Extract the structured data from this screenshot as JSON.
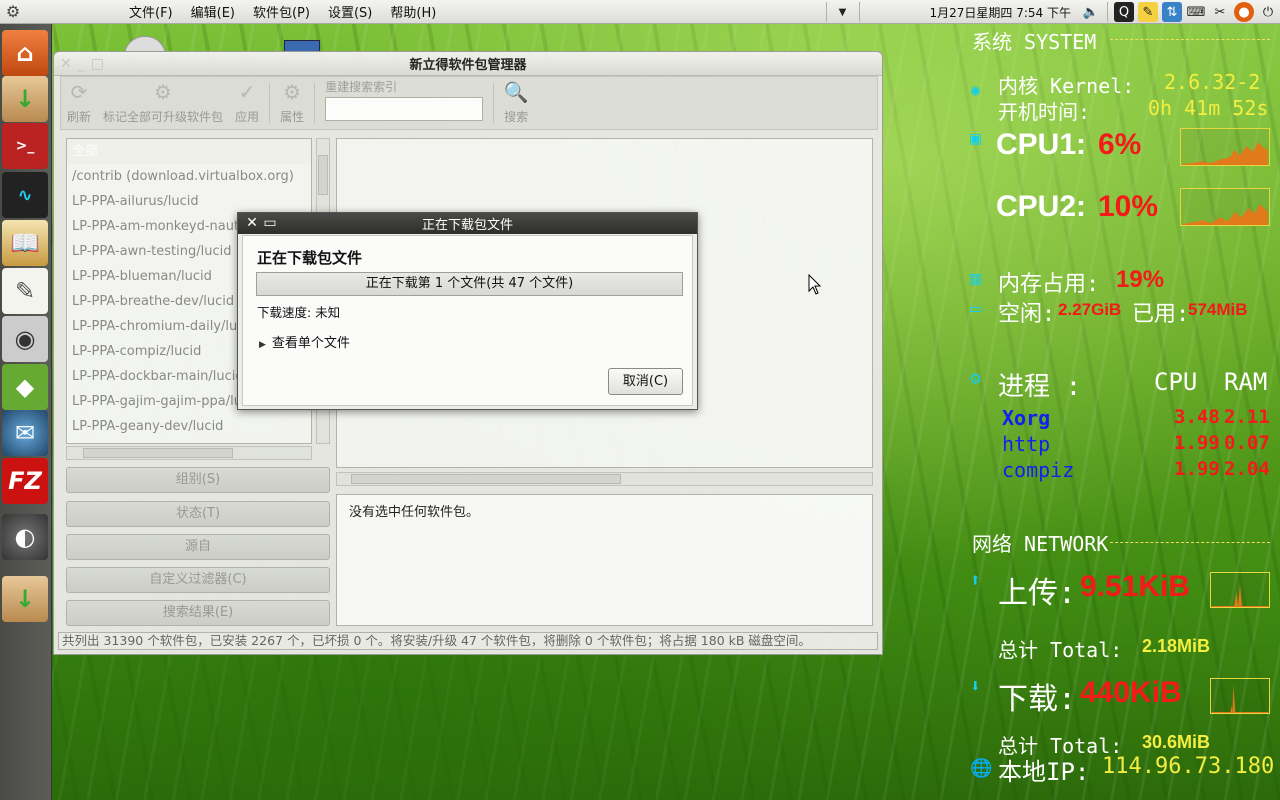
{
  "top_panel": {
    "menus": [
      "文件(F)",
      "编辑(E)",
      "软件包(P)",
      "设置(S)",
      "帮助(H)"
    ],
    "clock": "1月27日星期四  7:54 下午"
  },
  "main_window": {
    "title": "新立得软件包管理器",
    "toolbar": {
      "refresh": "刷新",
      "mark_all_upgrades": "标记全部可升级软件包",
      "apply": "应用",
      "properties": "属性",
      "search_index_label": "重建搜索索引",
      "search": "搜索"
    },
    "filter_items": [
      "全部",
      "/contrib (download.virtualbox.org)",
      "LP-PPA-ailurus/lucid",
      "LP-PPA-am-monkeyd-nautilus",
      "LP-PPA-awn-testing/lucid",
      "LP-PPA-blueman/lucid",
      "LP-PPA-breathe-dev/lucid",
      "LP-PPA-chromium-daily/lucid",
      "LP-PPA-compiz/lucid",
      "LP-PPA-dockbar-main/lucid",
      "LP-PPA-gajim-gajim-ppa/lucid",
      "LP-PPA-geany-dev/lucid"
    ],
    "side_buttons": [
      "组别(S)",
      "状态(T)",
      "源自",
      "自定义过滤器(C)",
      "搜索结果(E)"
    ],
    "description": "没有选中任何软件包。",
    "status": "共列出 31390 个软件包，已安装 2267 个，已坏损 0 个。将安装/升级 47 个软件包，将删除 0 个软件包；将占据 180 kB 磁盘空间。"
  },
  "dialog": {
    "title": "正在下载包文件",
    "heading": "正在下载包文件",
    "progress_text": "正在下载第 1 个文件(共 47 个文件)",
    "progress_fraction": 0.0,
    "speed": "下载速度: 未知",
    "expander": "查看单个文件",
    "cancel": "取消(C)"
  },
  "conky": {
    "system_header": "系统 SYSTEM",
    "kernel_label": "内核 Kernel:",
    "kernel_value": "2.6.32-2",
    "uptime_label": "开机时间:",
    "uptime_value": "0h 41m 52s",
    "cpu1_label": "CPU1:",
    "cpu1_value": "6%",
    "cpu2_label": "CPU2:",
    "cpu2_value": "10%",
    "mem_label": "内存占用:",
    "mem_value": "19%",
    "free_label": "空闲:",
    "free_value": "2.27GiB",
    "used_label": "已用:",
    "used_value": "574MiB",
    "proc_label": "进程 :",
    "proc_cpu": "CPU",
    "proc_ram": "RAM",
    "processes": [
      {
        "name": "Xorg",
        "cpu": "3.48",
        "ram": "2.11"
      },
      {
        "name": "http",
        "cpu": "1.99",
        "ram": "0.07"
      },
      {
        "name": "compiz",
        "cpu": "1.99",
        "ram": "2.04"
      }
    ],
    "net_header": "网络 NETWORK",
    "up_label": "上传:",
    "up_value": "9.51KiB",
    "up_total_label": "总计 Total:",
    "up_total": "2.18MiB",
    "down_label": "下载:",
    "down_value": "440KiB",
    "down_total_label": "总计 Total:",
    "down_total": "30.6MiB",
    "ip_label": "本地IP:",
    "ip_value": "114.96.73.180"
  },
  "colors": {
    "conky_accent": "#f3ee40",
    "conky_alert": "#f41a1a",
    "conky_process": "#1022ee"
  }
}
